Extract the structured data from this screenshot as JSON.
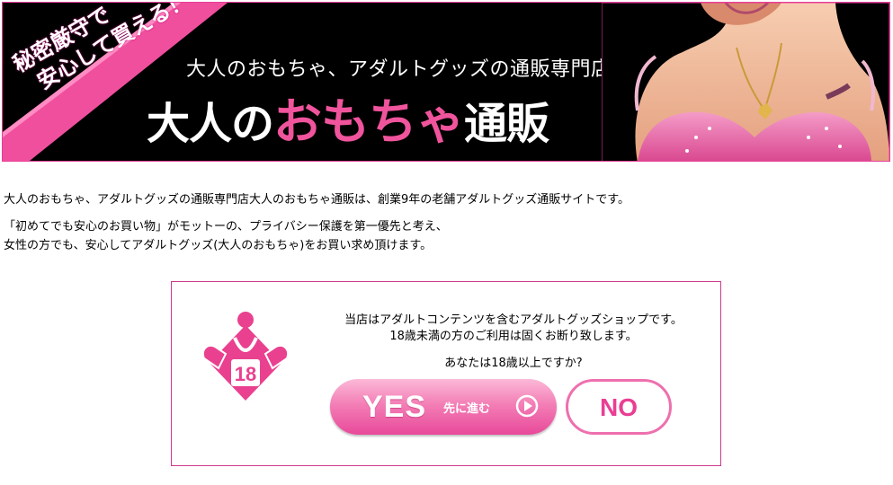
{
  "header": {
    "ribbon_lines": [
      "秘密厳守で",
      "安心して買える！"
    ],
    "subtitle": "大人のおもちゃ、アダルトグッズの通販専門店",
    "title_part1": "大人の",
    "title_highlight": "おもちゃ",
    "title_part2": "通販"
  },
  "intro": {
    "line1": "大人のおもちゃ、アダルトグッズの通販専門店大人のおもちゃ通販は、創業9年の老舗アダルトグッズ通販サイトです。",
    "line2": "「初めてでも安心のお買い物」がモットーの、プライバシー保護を第一優先と考え、",
    "line3": "女性の方でも、安心してアダルトグッズ(大人のおもちゃ)をお買い求め頂けます。"
  },
  "age_gate": {
    "badge_number": "18",
    "message_line1": "当店はアダルトコンテンツを含むアダルトグッズショップです。",
    "message_line2": "18歳未満の方のご利用は固くお断り致します。",
    "question": "あなたは18歳以上ですか?",
    "yes_label": "YES",
    "yes_sub": "先に進む",
    "no_label": "NO"
  },
  "colors": {
    "accent_pink": "#e83e97",
    "banner_bg": "#000000",
    "no_text": "#e93e94"
  },
  "icons": [
    "age-18-badge-icon",
    "arrow-right-circle-icon"
  ]
}
